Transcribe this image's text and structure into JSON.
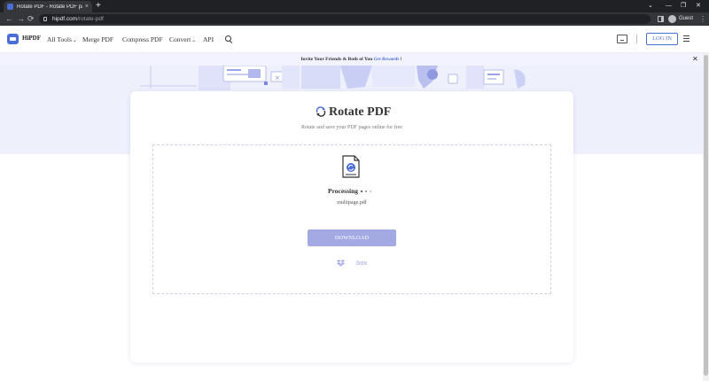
{
  "browser": {
    "tab_title": "Rotate PDF - Rotate PDF pages o",
    "tab_close": "×",
    "new_tab": "+",
    "url_host": "hipdf.com",
    "url_path": "/rotate-pdf",
    "profile_label": "Guest",
    "nav_back": "←",
    "nav_forward": "→",
    "nav_reload": "⟳",
    "win_min": "—",
    "win_max": "❐",
    "win_close": "✕",
    "win_dropdown": "⌄",
    "menu": "⋮"
  },
  "header": {
    "logo_text": "HiPDF",
    "nav": {
      "all_tools": "All Tools",
      "merge_pdf": "Merge PDF",
      "compress_pdf": "Compress PDF",
      "convert": "Convert",
      "api": "API"
    },
    "caret": "⌄",
    "login_label": "LOG IN"
  },
  "banner": {
    "text": "Invite Your Friends & Both of You",
    "link": "Get Rewards",
    "suffix": " !",
    "close": "✕"
  },
  "main": {
    "title": "Rotate PDF",
    "subtitle": "Rotate and save your PDF pages online for free",
    "status": "Processing",
    "file_name": "multipage.pdf",
    "download_label": "DOWNLOAD",
    "box_label": "box"
  },
  "colors": {
    "accent": "#4b6fd6",
    "download_disabled": "#a3aae3",
    "hero_bg": "#eef0fc"
  },
  "icons": {
    "logo": "hipdf-logo-icon",
    "rotate": "rotate-icon",
    "file": "pdf-file-icon",
    "search": "search-icon",
    "desktop": "desktop-download-icon",
    "menu": "hamburger-icon",
    "dropbox": "dropbox-icon"
  }
}
